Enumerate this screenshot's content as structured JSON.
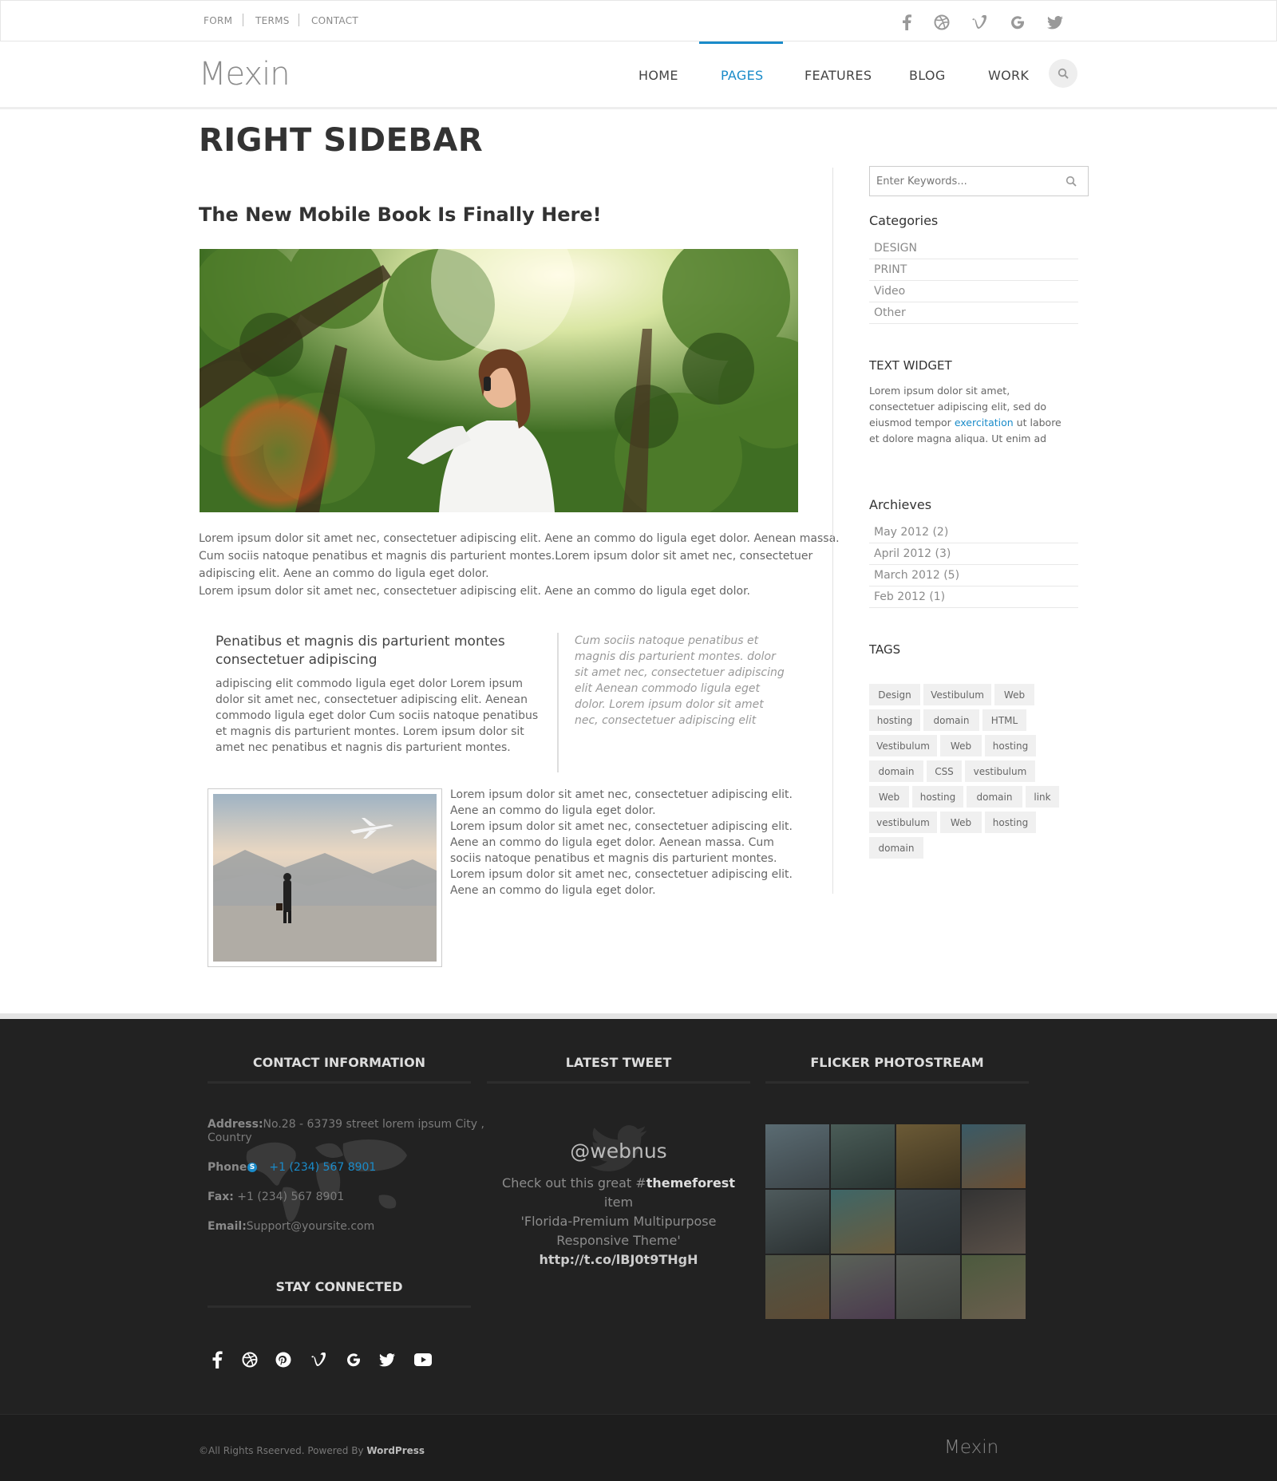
{
  "topbar": {
    "links": [
      "FORM",
      "TERMS",
      "CONTACT"
    ],
    "social": [
      "facebook-icon",
      "dribbble-icon",
      "vimeo-icon",
      "google-icon",
      "twitter-icon"
    ]
  },
  "header": {
    "logo": "Mexin",
    "nav": [
      "HOME",
      "PAGES",
      "FEATURES",
      "BLOG",
      "WORK"
    ],
    "active_nav": "PAGES"
  },
  "page": {
    "title": "RIGHT SIDEBAR",
    "post_title": "The New Mobile Book Is Finally Here!",
    "intro_p1": "Lorem ipsum dolor sit amet nec, consectetuer adipiscing elit. Aene an commo do ligula eget dolor. Aenean massa.",
    "intro_p2": "Cum sociis natoque penatibus et magnis dis parturient montes.Lorem ipsum dolor sit amet nec, consectetuer",
    "intro_p3": "adipiscing elit. Aene an commo do ligula eget dolor.",
    "intro_p4": "Lorem ipsum dolor sit amet nec, consectetuer adipiscing elit. Aene an commo do ligula eget dolor.",
    "col_title": "Penatibus et magnis dis parturient montes consectetuer adipiscing",
    "col_text": "adipiscing elit commodo ligula eget dolor Lorem ipsum dolor sit amet nec, consectetuer adipiscing elit. Aenean commodo ligula eget dolor Cum sociis natoque penatibus et magnis dis parturient montes. Lorem ipsum dolor sit amet nec penatibus et nagnis dis parturient montes.",
    "quote": "Cum sociis natoque penatibus et magnis dis parturient montes. dolor sit amet nec, consectetuer adipiscing elit Aenean commodo ligula eget dolor. Lorem ipsum dolor sit amet nec, consectetuer adipiscing elit",
    "side_p1": "Lorem ipsum dolor sit amet nec, consectetuer adipiscing elit. Aene an commo do ligula eget dolor.",
    "side_p2": "Lorem ipsum dolor sit amet nec, consectetuer adipiscing elit. Aene an commo do ligula eget dolor. Aenean massa. Cum sociis natoque penatibus et magnis dis parturient montes. Lorem ipsum dolor sit amet nec, consectetuer adipiscing elit. Aene an commo do ligula eget dolor."
  },
  "sidebar": {
    "search_placeholder": "Enter Keywords...",
    "categories_title": "Categories",
    "categories": [
      "DESIGN",
      "PRINT",
      "Video",
      "Other"
    ],
    "text_widget_title": "TEXT WIDGET",
    "text_widget_a": "Lorem ipsum dolor sit amet, consectetuer adipiscing elit, sed do eiusmod tempor",
    "text_widget_link": "exercitation",
    "text_widget_b": " ut labore et dolore magna aliqua. Ut enim ad",
    "archives_title": "Archieves",
    "archives": [
      "May 2012 (2)",
      "April 2012 (3)",
      "March 2012 (5)",
      "Feb 2012 (1)"
    ],
    "tags_title": "TAGS",
    "tags": [
      "Design",
      "Vestibulum",
      "Web",
      "hosting",
      "domain",
      "HTML",
      "Vestibulum",
      "Web",
      "hosting",
      "domain",
      "CSS",
      "vestibulum",
      "Web",
      "hosting",
      "domain",
      "link",
      "vestibulum",
      "Web",
      "hosting",
      "domain"
    ]
  },
  "footer": {
    "contact_title": "CONTACT INFORMATION",
    "address_label": "Address:",
    "address_value": "No.28 - 63739 street lorem ipsum City ,",
    "address_value2": "Country",
    "phone_label": "Phone:",
    "phone_value": "+1 (234) 567 8901",
    "fax_label": "Fax:",
    "fax_value": " +1 (234) 567 8901",
    "email_label": "Email:",
    "email_value": "Support@yoursite.com",
    "stay_title": "STAY CONNECTED",
    "stay_icons": [
      "facebook-icon",
      "dribbble-icon",
      "pinterest-icon",
      "vimeo-icon",
      "google-icon",
      "twitter-icon",
      "youtube-icon"
    ],
    "tweet_title": "LATEST TWEET",
    "tweet_handle": "@webnus",
    "tweet_a": "Check out this great #",
    "tweet_tag": "themeforest",
    "tweet_b": " item",
    "tweet_line2": "'Florida-Premium Multipurpose",
    "tweet_line3": "Responsive Theme'",
    "tweet_link": "http://t.co/lBJ0t9THgH",
    "flicker_title": "FLICKER PHOTOSTREAM",
    "copyright": "©All Rights Rseerved. Powered By ",
    "copyright_link": "WordPress",
    "footer_logo": "Mexin"
  },
  "colors": {
    "accent": "#1a8bc9",
    "footer_bg": "#222222"
  }
}
